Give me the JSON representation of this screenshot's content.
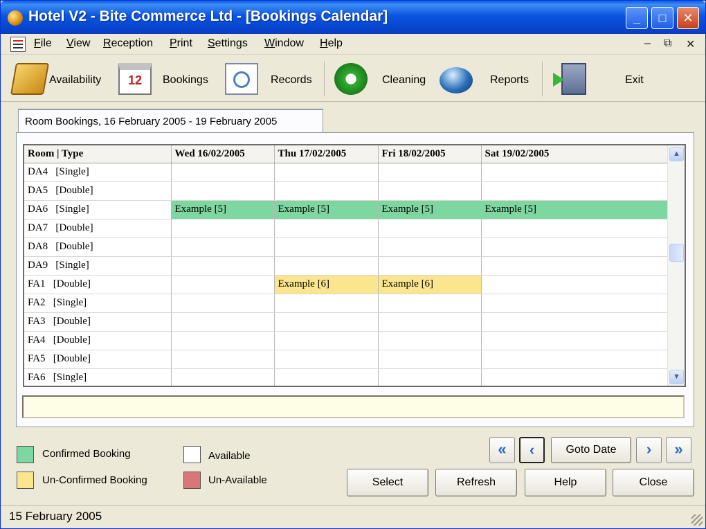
{
  "window": {
    "title": "Hotel V2 - Bite Commerce Ltd - [Bookings Calendar]"
  },
  "menu": {
    "items": [
      "File",
      "View",
      "Reception",
      "Print",
      "Settings",
      "Window",
      "Help"
    ]
  },
  "toolbar": {
    "items": [
      {
        "label": "Availability",
        "icon": "availability-book-icon"
      },
      {
        "label": "Bookings",
        "icon": "calendar-icon",
        "icon_text": "12"
      },
      {
        "label": "Records",
        "icon": "records-search-icon"
      },
      {
        "label": "Cleaning",
        "icon": "recycle-icon"
      },
      {
        "label": "Reports",
        "icon": "globe-icon"
      },
      {
        "label": "Exit",
        "icon": "exit-door-icon"
      }
    ]
  },
  "tab": {
    "label": "Room Bookings, 16 February 2005 - 19 February 2005"
  },
  "grid": {
    "columns": [
      "Room | Type",
      "Wed 16/02/2005",
      "Thu 17/02/2005",
      "Fri 18/02/2005",
      "Sat 19/02/2005"
    ],
    "rows": [
      {
        "room": "DA4   [Single]",
        "cells": [
          "",
          "",
          "",
          ""
        ]
      },
      {
        "room": "DA5   [Double]",
        "cells": [
          "",
          "",
          "",
          ""
        ]
      },
      {
        "room": "DA6   [Single]",
        "cells": [
          "Example [5]",
          "Example [5]",
          "Example [5]",
          "Example [5]"
        ],
        "status": [
          "confirmed",
          "confirmed",
          "confirmed",
          "confirmed"
        ]
      },
      {
        "room": "DA7   [Double]",
        "cells": [
          "",
          "",
          "",
          ""
        ]
      },
      {
        "room": "DA8   [Double]",
        "cells": [
          "",
          "",
          "",
          ""
        ]
      },
      {
        "room": "DA9   [Single]",
        "cells": [
          "",
          "",
          "",
          ""
        ]
      },
      {
        "room": "FA1   [Double]",
        "cells": [
          "",
          "Example [6]",
          "Example [6]",
          ""
        ],
        "status": [
          "",
          "unconfirmed",
          "unconfirmed",
          ""
        ]
      },
      {
        "room": "FA2   [Single]",
        "cells": [
          "",
          "",
          "",
          ""
        ]
      },
      {
        "room": "FA3   [Double]",
        "cells": [
          "",
          "",
          "",
          ""
        ]
      },
      {
        "room": "FA4   [Double]",
        "cells": [
          "",
          "",
          "",
          ""
        ]
      },
      {
        "room": "FA5   [Double]",
        "cells": [
          "",
          "",
          "",
          ""
        ]
      },
      {
        "room": "FA6   [Single]",
        "cells": [
          "",
          "",
          "",
          ""
        ]
      }
    ]
  },
  "legend": {
    "confirmed": {
      "label": "Confirmed Booking",
      "color": "#7ed6a0"
    },
    "unconfirmed": {
      "label": "Un-Confirmed Booking",
      "color": "#fbe58e"
    },
    "available": {
      "label": "Available",
      "color": "#ffffff"
    },
    "unavailable": {
      "label": "Un-Available",
      "color": "#d9767a"
    }
  },
  "navigation": {
    "goto_label": "Goto Date"
  },
  "buttons": {
    "select": "Select",
    "refresh": "Refresh",
    "help": "Help",
    "close": "Close"
  },
  "status": {
    "date": "15 February 2005"
  }
}
